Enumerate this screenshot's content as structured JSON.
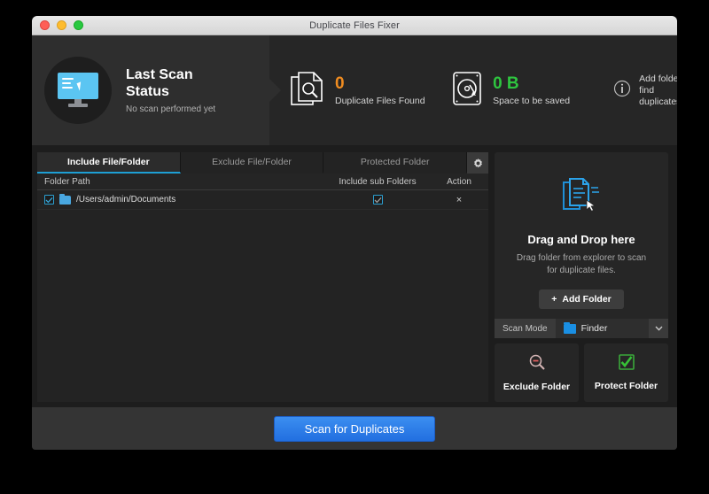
{
  "window": {
    "title": "Duplicate Files Fixer",
    "traffic_lights": [
      "close-red",
      "minimize-yellow",
      "maximize-green"
    ]
  },
  "header": {
    "scan_status": {
      "icon": "monitor-cursor-icon",
      "title_line1": "Last Scan",
      "title_line2": "Status",
      "subtitle": "No scan performed yet"
    },
    "stats": [
      {
        "icon": "document-search-icon",
        "value": "0",
        "label": "Duplicate Files Found",
        "color": "#f08c20"
      },
      {
        "icon": "hard-disk-icon",
        "value": "0 B",
        "label": "Space to be saved",
        "color": "#2ec53f"
      }
    ],
    "info": {
      "icon": "info-icon",
      "line1": "Add folder to",
      "line2": "find duplicates"
    }
  },
  "tabs": [
    {
      "label": "Include File/Folder",
      "active": true
    },
    {
      "label": "Exclude File/Folder",
      "active": false
    },
    {
      "label": "Protected Folder",
      "active": false
    }
  ],
  "tab_settings_icon": "gear-icon",
  "table": {
    "headers": {
      "path": "Folder Path",
      "subfolders": "Include sub Folders",
      "action": "Action"
    },
    "rows": [
      {
        "checked": true,
        "folder_icon": "folder-icon",
        "path": "/Users/admin/Documents",
        "include_subfolders": true,
        "action": "×"
      }
    ]
  },
  "drop_zone": {
    "icon": "documents-drag-icon",
    "title": "Drag and Drop here",
    "description": "Drag folder from explorer to scan for duplicate files.",
    "add_button": {
      "icon": "plus-icon",
      "label": "Add Folder"
    }
  },
  "scan_mode": {
    "label": "Scan Mode",
    "selected": "Finder",
    "selected_icon": "blue-folder-icon",
    "caret": "chevron-down-icon"
  },
  "action_cards": [
    {
      "icon": "magnifier-minus-icon",
      "label": "Exclude Folder"
    },
    {
      "icon": "green-check-box-icon",
      "label": "Protect Folder"
    }
  ],
  "footer": {
    "scan_button": "Scan for Duplicates"
  },
  "colors": {
    "accent_blue": "#1e9fd4",
    "button_blue": "#2a7ce6",
    "orange": "#f08c20",
    "green": "#2ec53f",
    "window_bg": "#2b2b2b"
  }
}
